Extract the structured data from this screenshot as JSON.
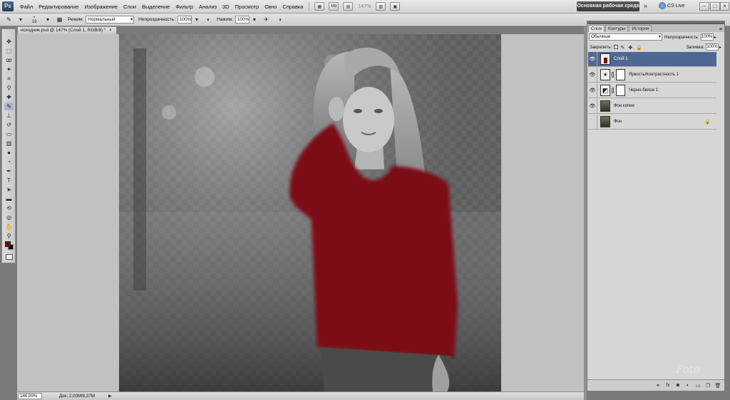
{
  "menubar": {
    "logo": "Ps",
    "items": [
      "Файл",
      "Редактирование",
      "Изображение",
      "Слои",
      "Выделение",
      "Фильтр",
      "Анализ",
      "3D",
      "Просмотр",
      "Окно",
      "Справка"
    ],
    "mb_label": "Mb",
    "zoom": "147%",
    "workspace": "Основная рабочая среда",
    "cslive": "CS Live"
  },
  "options": {
    "brush_size": "19",
    "mode_label": "Режим:",
    "mode_value": "Нормальный",
    "opacity_label": "Непрозрачность:",
    "opacity_value": "100%",
    "pressure_label": "Нажим:",
    "pressure_value": "100%"
  },
  "document": {
    "tab_title": "исходник.psd @ 147% (Слой 1, RGB/8) *"
  },
  "status": {
    "zoom": "146,99%",
    "doc": "Док: 2,00M/6,37M"
  },
  "layers": {
    "tabs": [
      "Слои",
      "Контуры",
      "История"
    ],
    "blend_mode": "Обычные",
    "opacity_label": "Непрозрачность:",
    "opacity_value": "100%",
    "lock_label": "Закрепить:",
    "fill_label": "Заливка:",
    "fill_value": "100%",
    "items": [
      {
        "name": "Слой 1"
      },
      {
        "name": "Яркость/Контрастность 1"
      },
      {
        "name": "Черно-белое 1"
      },
      {
        "name": "Фон копия"
      },
      {
        "name": "Фон"
      }
    ]
  },
  "watermark": "Foto",
  "colors": {
    "foreground": "#7a0010",
    "background": "#000000",
    "sweater": "#7c0812",
    "selected_layer": "#4f6793"
  }
}
